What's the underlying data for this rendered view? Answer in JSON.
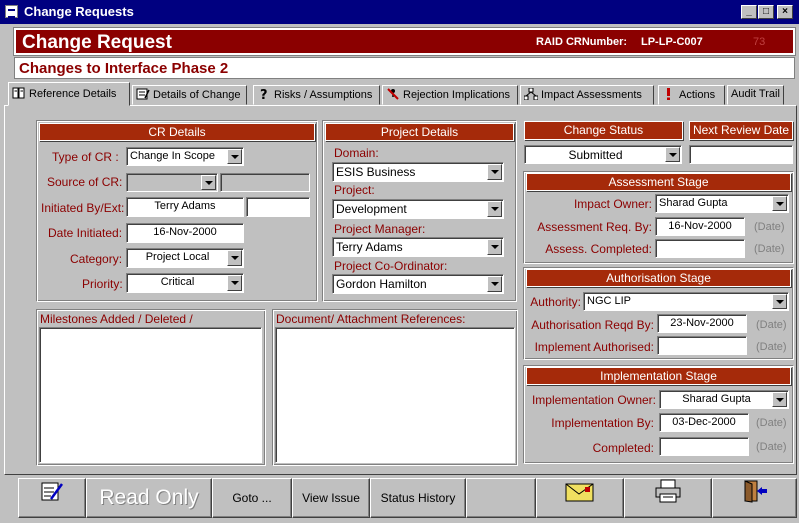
{
  "window": {
    "title": "Change Requests"
  },
  "header": {
    "title": "Change Request",
    "raid_label": "RAID CRNumber:",
    "raid_value": "LP-LP-C007",
    "raid_id": "73",
    "subtitle": "Changes to Interface Phase 2"
  },
  "tabs": [
    {
      "label": "Reference Details",
      "icon": "book-icon"
    },
    {
      "label": "Details of Change",
      "icon": "notepad-icon"
    },
    {
      "label": "Risks / Assumptions",
      "icon": "question-icon"
    },
    {
      "label": "Rejection Implications",
      "icon": "rejection-icon"
    },
    {
      "label": "Impact Assessments",
      "icon": "network-icon"
    },
    {
      "label": "Actions",
      "icon": "exclamation-icon"
    },
    {
      "label": "Audit Trail",
      "icon": ""
    }
  ],
  "cr_details": {
    "header": "CR Details",
    "type_label": "Type of CR  :",
    "type_value": "Change In Scope",
    "source_label": "Source of CR:",
    "initiated_label": "Initiated By/Ext:",
    "initiated_value": "Terry Adams",
    "date_label": "Date Initiated:",
    "date_value": "16-Nov-2000",
    "category_label": "Category:",
    "category_value": "Project Local",
    "priority_label": "Priority:",
    "priority_value": "Critical"
  },
  "project_details": {
    "header": "Project Details",
    "domain_label": "Domain:",
    "domain_value": "ESIS Business",
    "project_label": "Project:",
    "project_value": "Development",
    "manager_label": "Project Manager:",
    "manager_value": "Terry Adams",
    "coordinator_label": "Project Co-Ordinator:",
    "coordinator_value": "Gordon Hamilton"
  },
  "change_status": {
    "header": "Change Status",
    "value": "Submitted",
    "next_review_header": "Next Review Date"
  },
  "assessment": {
    "header": "Assessment Stage",
    "owner_label": "Impact Owner:",
    "owner_value": "Sharad Gupta",
    "req_label": "Assessment  Req. By:",
    "req_value": "16-Nov-2000",
    "completed_label": "Assess. Completed:",
    "date_hint": "(Date)"
  },
  "authorisation": {
    "header": "Authorisation Stage",
    "authority_label": "Authority:",
    "authority_value": "NGC LIP",
    "reqd_label": "Authorisation Reqd By:",
    "reqd_value": "23-Nov-2000",
    "impl_label": "Implement Authorised:",
    "date_hint": "(Date)"
  },
  "implementation": {
    "header": "Implementation Stage",
    "owner_label": "Implementation Owner:",
    "owner_value": "Sharad Gupta",
    "by_label": "Implementation By:",
    "by_value": "03-Dec-2000",
    "completed_label": "Completed:",
    "date_hint": "(Date)"
  },
  "lists": {
    "milestones": "Milestones Added / Deleted /",
    "documents": "Document/ Attachment References:"
  },
  "toolbar": {
    "read_only": "Read Only",
    "goto": "Goto ...",
    "view_issue": "View Issue",
    "status_history": "Status History"
  }
}
